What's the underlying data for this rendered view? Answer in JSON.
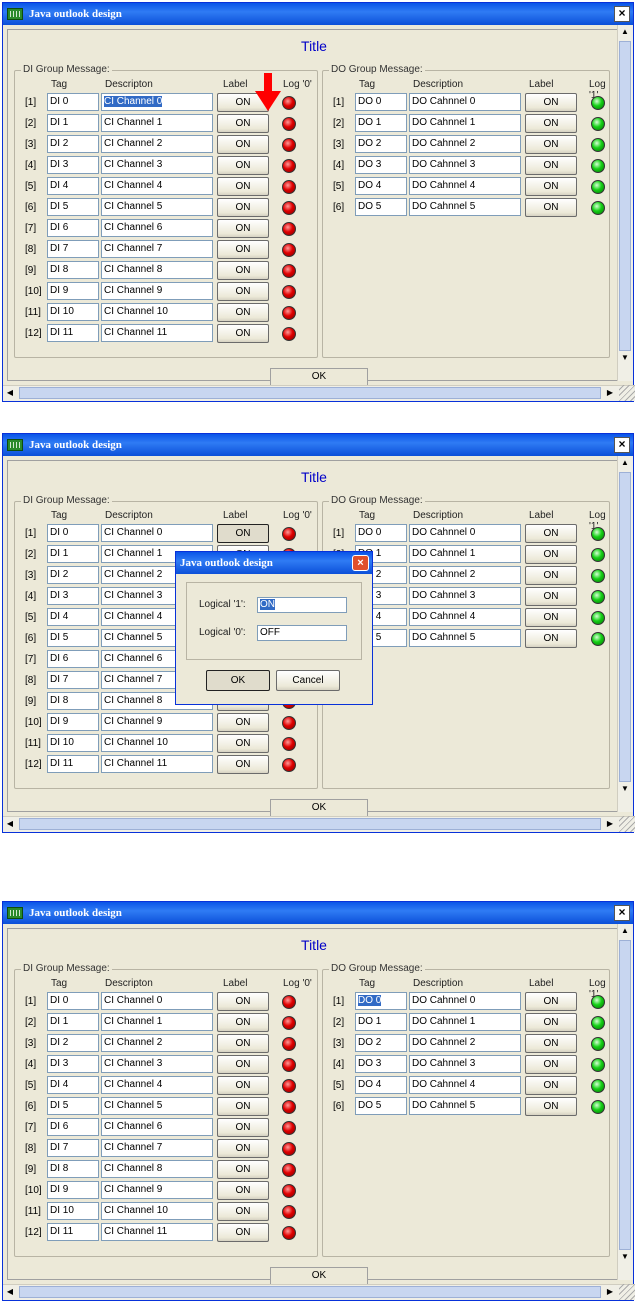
{
  "app": {
    "title": "Java outlook design",
    "page_title": "Title",
    "ok_label": "OK",
    "close_glyph": "×"
  },
  "di_group": {
    "label": "DI Group Message:",
    "col_tag": "Tag",
    "col_desc": "Descripton",
    "col_label": "Label",
    "col_log": "Log '0'",
    "rows": [
      {
        "idx": "[1]",
        "tag": "DI 0",
        "desc": "CI Channel 0",
        "btn": "ON"
      },
      {
        "idx": "[2]",
        "tag": "DI 1",
        "desc": "CI Channel 1",
        "btn": "ON"
      },
      {
        "idx": "[3]",
        "tag": "DI 2",
        "desc": "CI Channel 2",
        "btn": "ON"
      },
      {
        "idx": "[4]",
        "tag": "DI 3",
        "desc": "CI Channel 3",
        "btn": "ON"
      },
      {
        "idx": "[5]",
        "tag": "DI 4",
        "desc": "CI Channel 4",
        "btn": "ON"
      },
      {
        "idx": "[6]",
        "tag": "DI 5",
        "desc": "CI Channel 5",
        "btn": "ON"
      },
      {
        "idx": "[7]",
        "tag": "DI 6",
        "desc": "CI Channel 6",
        "btn": "ON"
      },
      {
        "idx": "[8]",
        "tag": "DI 7",
        "desc": "CI Channel 7",
        "btn": "ON"
      },
      {
        "idx": "[9]",
        "tag": "DI 8",
        "desc": "CI Channel 8",
        "btn": "ON"
      },
      {
        "idx": "[10]",
        "tag": "DI 9",
        "desc": "CI Channel 9",
        "btn": "ON"
      },
      {
        "idx": "[11]",
        "tag": "DI 10",
        "desc": "CI Channel 10",
        "btn": "ON"
      },
      {
        "idx": "[12]",
        "tag": "DI 11",
        "desc": "CI Channel 11",
        "btn": "ON"
      }
    ]
  },
  "do_group": {
    "label": "DO Group Message:",
    "col_tag": "Tag",
    "col_desc": "Description",
    "col_label": "Label",
    "col_log": "Log '1'",
    "rows": [
      {
        "idx": "[1]",
        "tag": "DO 0",
        "desc": "DO Cahnnel 0",
        "btn": "ON"
      },
      {
        "idx": "[2]",
        "tag": "DO 1",
        "desc": "DO Cahnnel 1",
        "btn": "ON"
      },
      {
        "idx": "[3]",
        "tag": "DO 2",
        "desc": "DO Cahnnel 2",
        "btn": "ON"
      },
      {
        "idx": "[4]",
        "tag": "DO 3",
        "desc": "DO Cahnnel 3",
        "btn": "ON"
      },
      {
        "idx": "[5]",
        "tag": "DO 4",
        "desc": "DO Cahnnel 4",
        "btn": "ON"
      },
      {
        "idx": "[6]",
        "tag": "DO 5",
        "desc": "DO Cahnnel 5",
        "btn": "ON"
      }
    ]
  },
  "dialog": {
    "title": "Java outlook design",
    "label1": "Logical '1':",
    "value1": "ON",
    "label0": "Logical '0':",
    "value0": "OFF",
    "ok": "OK",
    "cancel": "Cancel",
    "close_glyph": "×"
  },
  "colors": {
    "led_di": "#e00000",
    "led_do": "#14d014",
    "title_blue": "#0000c8",
    "highlight": "#316ac5",
    "arrow": "#ff0000"
  },
  "panels": [
    {
      "di_selected": 0,
      "do_selected": null,
      "arrow": true,
      "dialog": false,
      "pressed": null
    },
    {
      "di_selected": null,
      "do_selected": null,
      "arrow": false,
      "dialog": true,
      "pressed": 0
    },
    {
      "di_selected": null,
      "do_selected": 0,
      "arrow": false,
      "dialog": false,
      "pressed": null
    }
  ]
}
